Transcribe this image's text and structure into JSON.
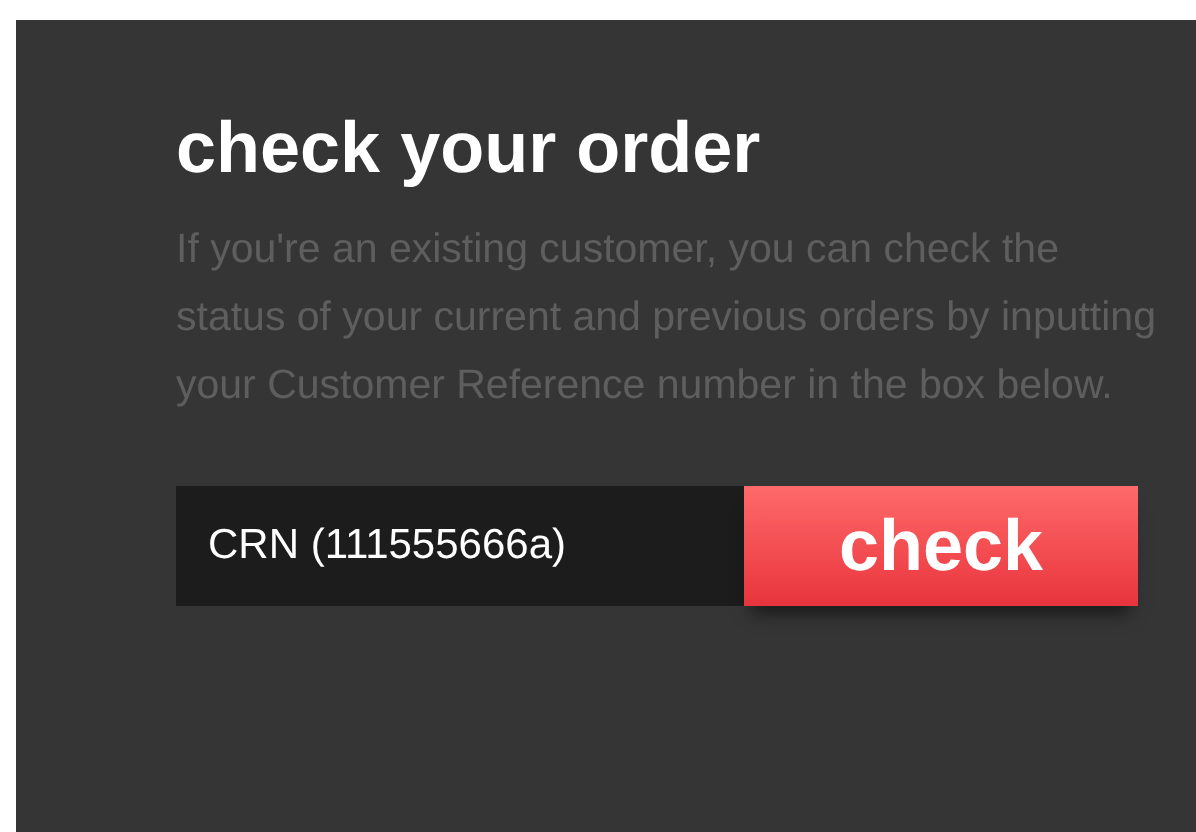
{
  "title": "check your order",
  "description": "If you're an existing customer, you can check the status of your current and previous orders by inputting your Customer Reference number in the box below.",
  "reference_field": {
    "value": "CRN (111555666a)"
  },
  "check_button": {
    "label": "check"
  }
}
